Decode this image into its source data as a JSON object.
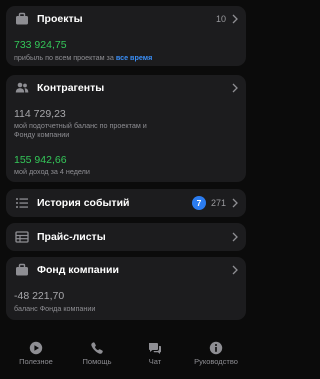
{
  "projects": {
    "title": "Проекты",
    "count": "10",
    "profit_value": "733 924,75",
    "profit_caption": "прибыль по всем проектам за",
    "period_link": "все время"
  },
  "contractors": {
    "title": "Контрагенты",
    "balance_value": "114 729,23",
    "balance_caption_line1": "мой подотчетный баланс по проектам и",
    "balance_caption_line2": "Фонду компании",
    "income_value": "155 942,66",
    "income_caption": "мой доход за 4 недели"
  },
  "events": {
    "title": "История событий",
    "badge": "7",
    "count": "271"
  },
  "price_lists": {
    "title": "Прайс-листы"
  },
  "company_fund": {
    "title": "Фонд компании",
    "balance_value": "-48 221,70",
    "balance_caption": "баланс Фонда компании"
  },
  "tabbar": {
    "items": [
      {
        "label": "Полезное",
        "icon": "play-icon"
      },
      {
        "label": "Помощь",
        "icon": "phone-icon"
      },
      {
        "label": "Чат",
        "icon": "chat-icon"
      },
      {
        "label": "Руководство",
        "icon": "info-icon"
      }
    ]
  },
  "colors": {
    "background": "#0b0b0b",
    "card": "#1c1c1e",
    "positive": "#34c759",
    "link": "#3a8ef6",
    "badge": "#2b7cf0",
    "secondary_text": "#8e8e93"
  }
}
